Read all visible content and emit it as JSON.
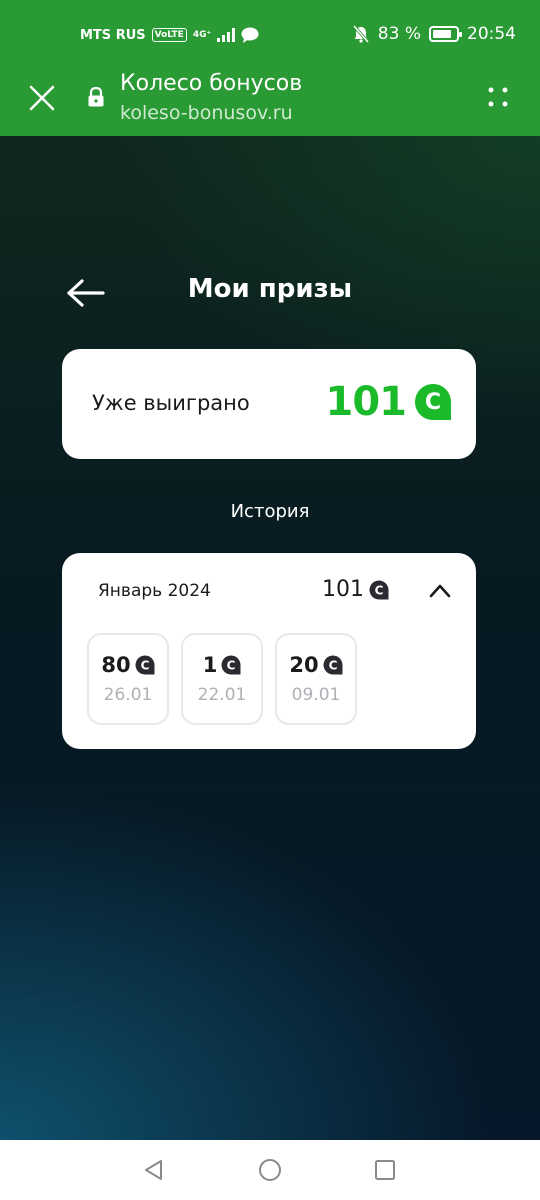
{
  "status_bar": {
    "carrier": "MTS RUS",
    "volte": "VoLTE",
    "network": "4G⁺",
    "battery_percent": "83 %",
    "battery_level": 0.83,
    "time": "20:54",
    "icons": [
      "signal-icon",
      "chat-bubble-icon",
      "bell-muted-icon",
      "battery-icon"
    ]
  },
  "browser": {
    "title": "Колесо бонусов",
    "url": "koleso-bonusov.ru",
    "bar_color": "#2a9a35"
  },
  "page": {
    "title": "Мои призы",
    "won": {
      "label": "Уже выиграно",
      "value": "101",
      "coin_letter": "С",
      "accent_color": "#1aba2a"
    },
    "history_label": "История",
    "history": {
      "month": "Январь 2024",
      "total": "101",
      "coin_letter": "С",
      "prizes": [
        {
          "value": "80",
          "date": "26.01"
        },
        {
          "value": "1",
          "date": "22.01"
        },
        {
          "value": "20",
          "date": "09.01"
        }
      ]
    }
  }
}
